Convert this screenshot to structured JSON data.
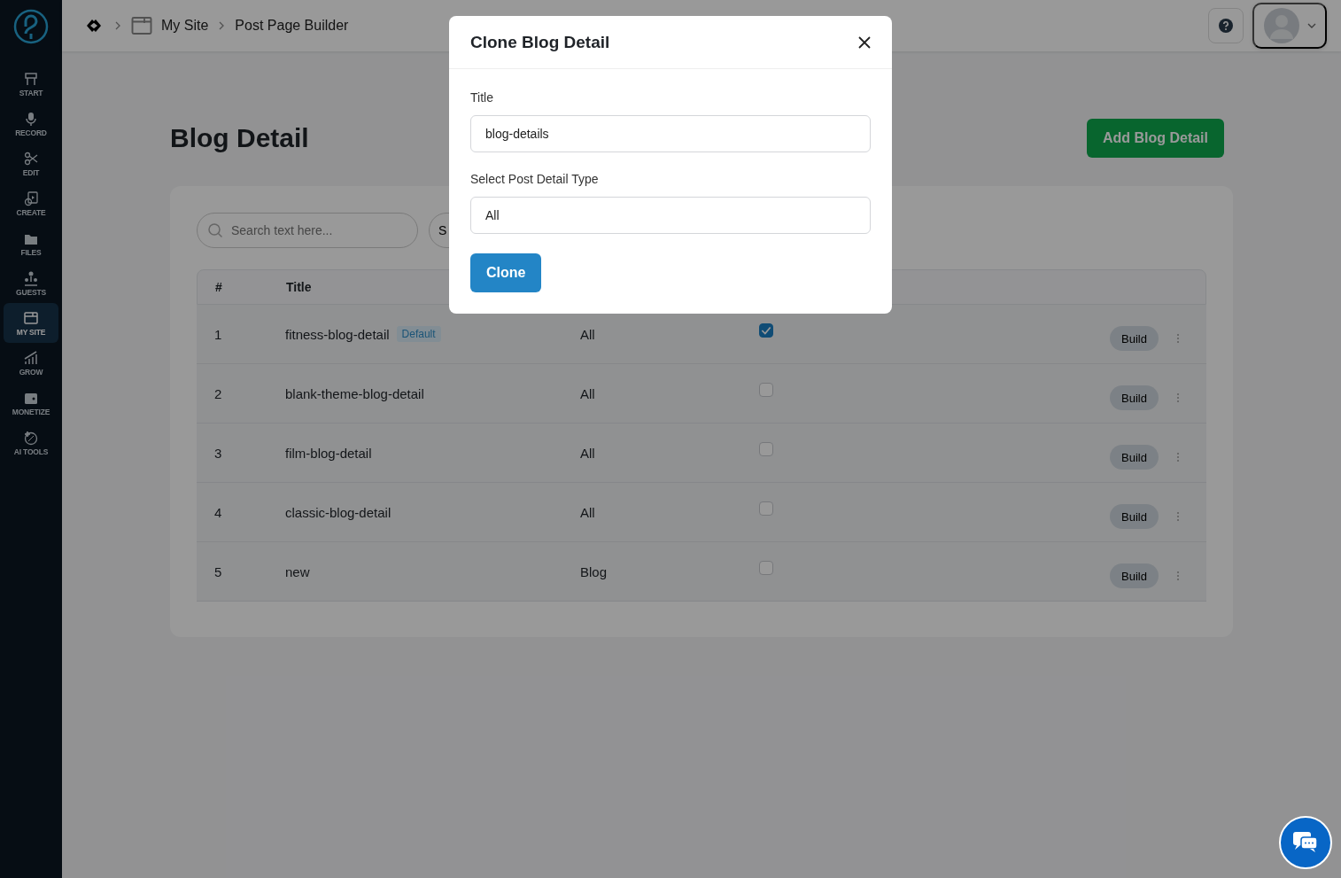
{
  "sidebar": {
    "items": [
      {
        "label": "START",
        "selected": false
      },
      {
        "label": "RECORD",
        "selected": false
      },
      {
        "label": "EDIT",
        "selected": false
      },
      {
        "label": "CREATE",
        "selected": false
      },
      {
        "label": "FILES",
        "selected": false
      },
      {
        "label": "GUESTS",
        "selected": false
      },
      {
        "label": "MY SITE",
        "selected": true
      },
      {
        "label": "GROW",
        "selected": false
      },
      {
        "label": "MONETIZE",
        "selected": false
      },
      {
        "label": "AI TOOLS",
        "selected": false
      }
    ]
  },
  "breadcrumb": [
    "My Site",
    "Post Page Builder"
  ],
  "page": {
    "title": "Blog Detail",
    "add_button": "Add Blog Detail"
  },
  "toolbar": {
    "search": {
      "placeholder": "Search text here..."
    },
    "filter_button": "S"
  },
  "table": {
    "columns": [
      "#",
      "Title"
    ],
    "rows": [
      {
        "number": "1",
        "title": "fitness-blog-detail",
        "badge": "Default",
        "type": "All",
        "checked": true,
        "action": "Build"
      },
      {
        "number": "2",
        "title": "blank-theme-blog-detail",
        "type": "All",
        "checked": false,
        "action": "Build"
      },
      {
        "number": "3",
        "title": "film-blog-detail",
        "type": "All",
        "checked": false,
        "action": "Build"
      },
      {
        "number": "4",
        "title": "classic-blog-detail",
        "type": "All",
        "checked": false,
        "action": "Build"
      },
      {
        "number": "5",
        "title": "new",
        "type": "Blog",
        "checked": false,
        "action": "Build"
      }
    ]
  },
  "modal": {
    "title": "Clone Blog Detail",
    "fields": [
      {
        "label": "Title",
        "value": "blog-details"
      },
      {
        "label": "Select Post Detail Type",
        "value": "All"
      }
    ],
    "submit": "Clone"
  }
}
